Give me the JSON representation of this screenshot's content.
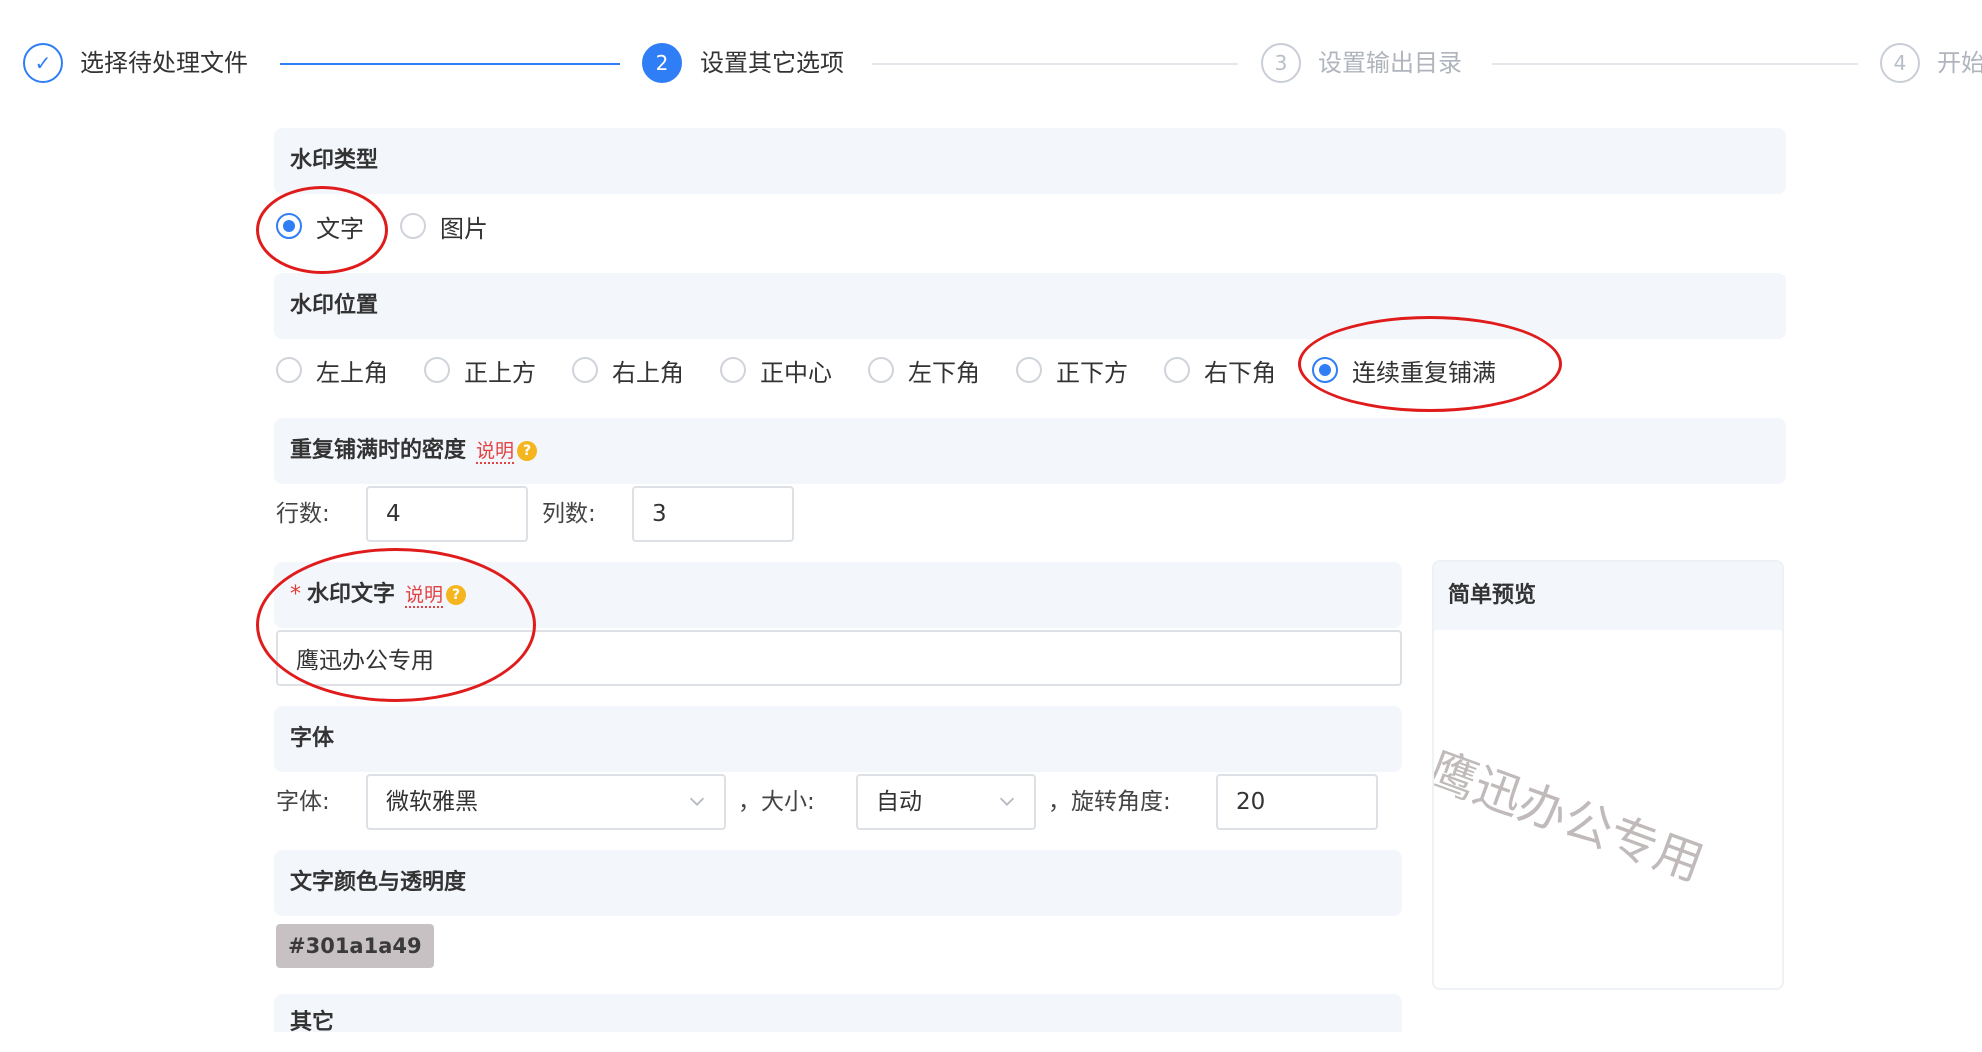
{
  "steps": [
    {
      "label": "选择待处理文件",
      "num": "✓",
      "state": "done"
    },
    {
      "label": "设置其它选项",
      "num": "2",
      "state": "active"
    },
    {
      "label": "设置输出目录",
      "num": "3",
      "state": "pending"
    },
    {
      "label": "开始",
      "num": "4",
      "state": "pending"
    }
  ],
  "watermark_type": {
    "title": "水印类型",
    "options": [
      {
        "label": "文字",
        "checked": true
      },
      {
        "label": "图片",
        "checked": false
      }
    ]
  },
  "position": {
    "title": "水印位置",
    "options": [
      {
        "label": "左上角",
        "checked": false
      },
      {
        "label": "正上方",
        "checked": false
      },
      {
        "label": "右上角",
        "checked": false
      },
      {
        "label": "正中心",
        "checked": false
      },
      {
        "label": "左下角",
        "checked": false
      },
      {
        "label": "正下方",
        "checked": false
      },
      {
        "label": "右下角",
        "checked": false
      },
      {
        "label": "连续重复铺满",
        "checked": true
      }
    ]
  },
  "density": {
    "title": "重复铺满时的密度",
    "tip": "说明",
    "rows_label": "行数:",
    "rows_value": "4",
    "cols_label": "列数:",
    "cols_value": "3"
  },
  "text": {
    "required_mark": "*",
    "title": "水印文字",
    "tip": "说明",
    "value": "鹰迅办公专用"
  },
  "font": {
    "title": "字体",
    "font_label": "字体:",
    "font_value": "微软雅黑",
    "size_label": "，大小:",
    "size_value": "自动",
    "rotate_label": "，旋转角度:",
    "rotate_value": "20"
  },
  "color": {
    "title": "文字颜色与透明度",
    "value": "#301a1a49"
  },
  "other": {
    "title": "其它"
  },
  "preview": {
    "title": "简单预览",
    "watermark": "鹰迅办公专用"
  },
  "colors": {
    "accent": "#2f7ef5",
    "section_bg": "#f3f6fb",
    "annotation": "#e01b1b"
  }
}
